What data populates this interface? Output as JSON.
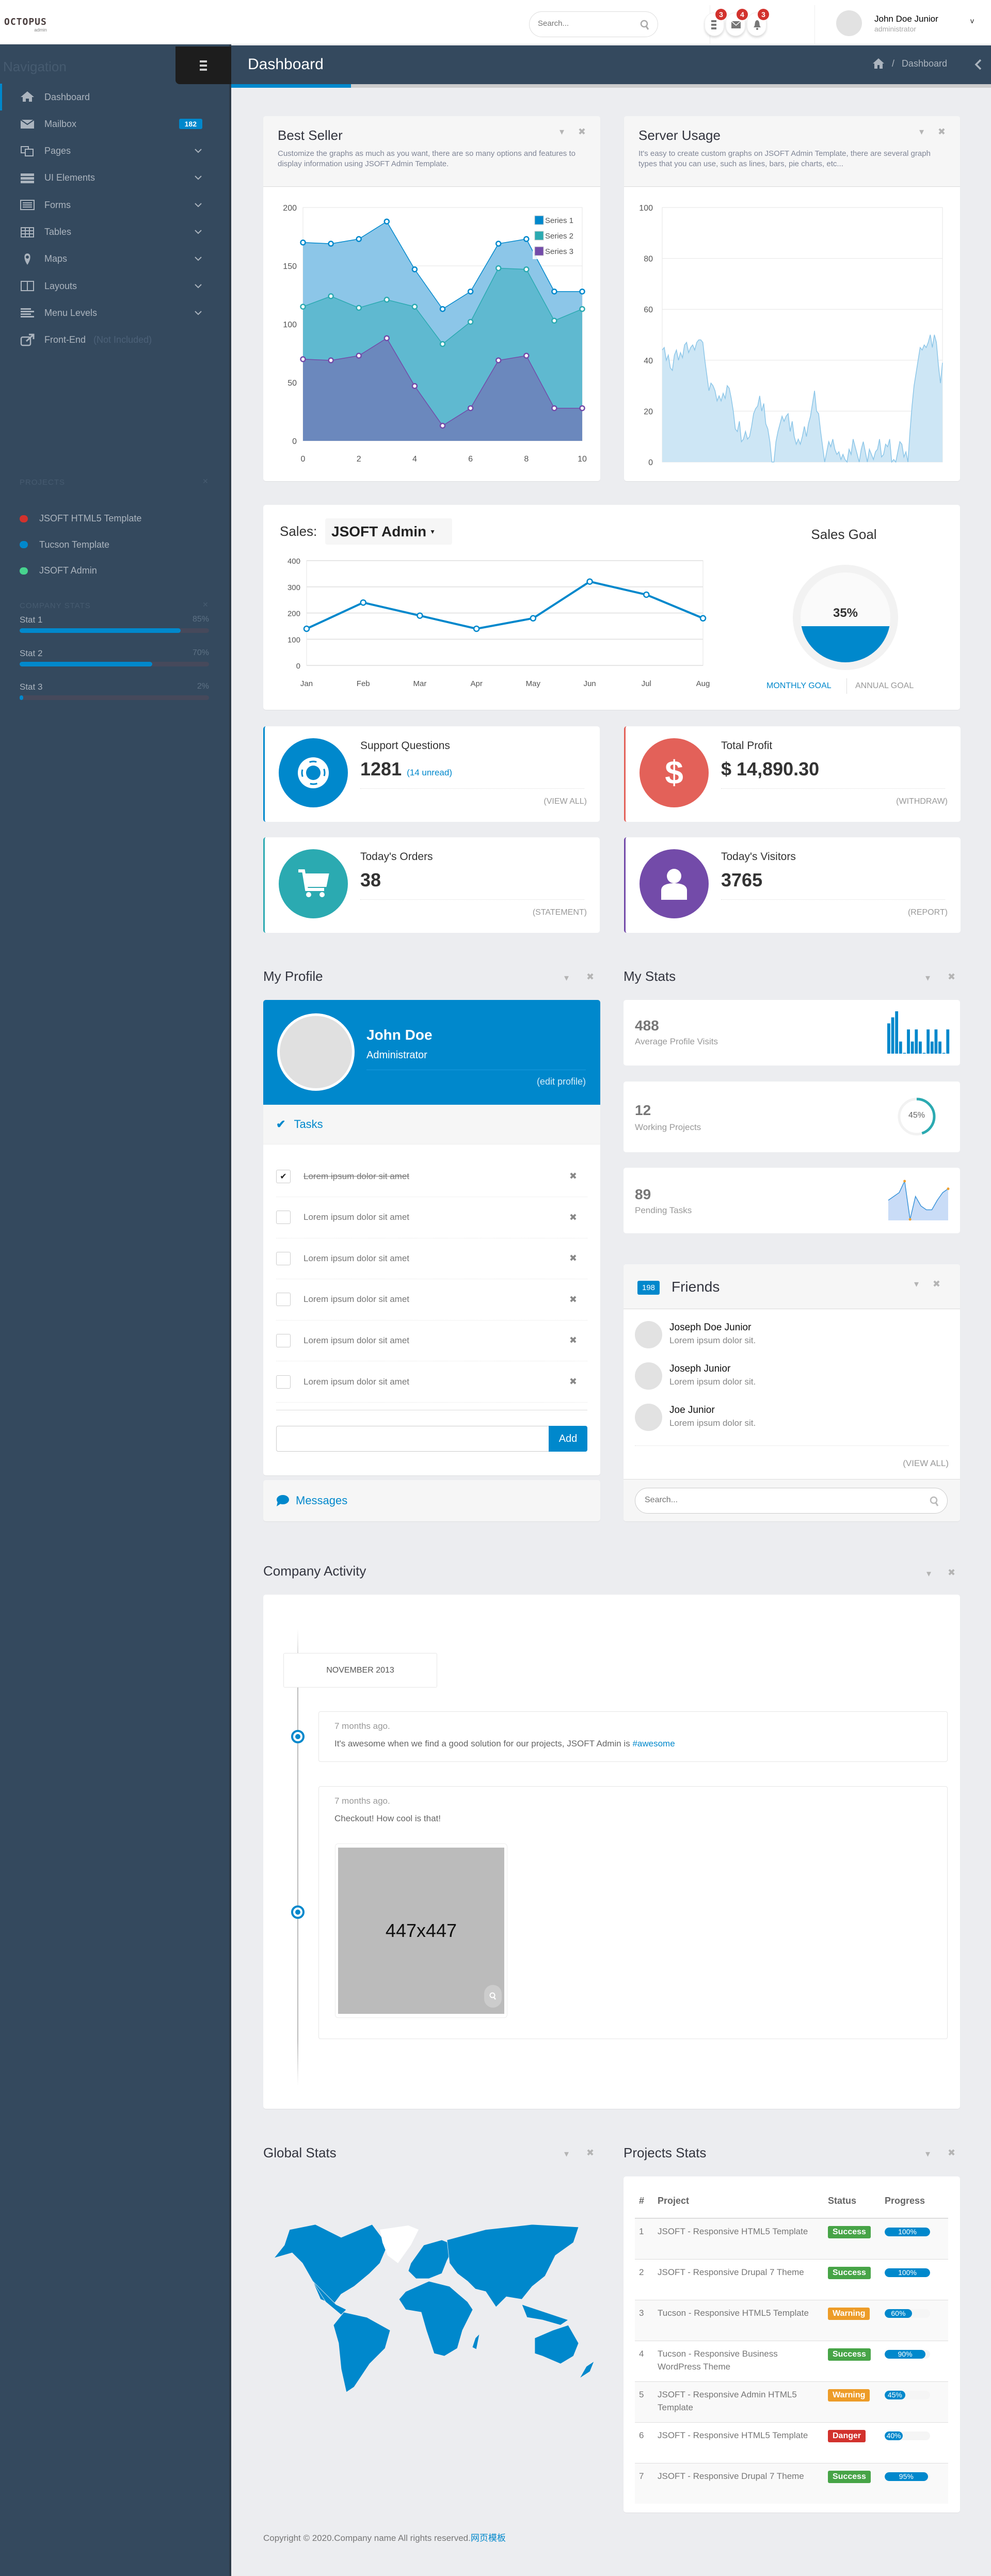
{
  "header": {
    "logo": "OCTOPUS",
    "logo_sub": "admin",
    "search_placeholder": "Search...",
    "notifications": [
      {
        "icon": "tasks-icon",
        "count": "3"
      },
      {
        "icon": "envelope-icon",
        "count": "4"
      },
      {
        "icon": "bell-icon",
        "count": "3"
      }
    ],
    "user_name": "John Doe Junior",
    "user_role": "administrator"
  },
  "page": {
    "title": "Dashboard",
    "breadcrumb": [
      "Dashboard"
    ]
  },
  "sidebar": {
    "nav_title": "Navigation",
    "items": [
      {
        "label": "Dashboard",
        "icon": "home-icon",
        "active": true
      },
      {
        "label": "Mailbox",
        "icon": "envelope-icon",
        "badge": "182"
      },
      {
        "label": "Pages",
        "icon": "copy-icon",
        "chevron": true
      },
      {
        "label": "UI Elements",
        "icon": "tasks-icon",
        "chevron": true
      },
      {
        "label": "Forms",
        "icon": "list-alt-icon",
        "chevron": true
      },
      {
        "label": "Tables",
        "icon": "table-icon",
        "chevron": true
      },
      {
        "label": "Maps",
        "icon": "map-marker-icon",
        "chevron": true
      },
      {
        "label": "Layouts",
        "icon": "columns-icon",
        "chevron": true
      },
      {
        "label": "Menu Levels",
        "icon": "align-left-icon",
        "chevron": true
      },
      {
        "label": "Front-End",
        "icon": "external-link-icon",
        "note": "(Not Included)"
      }
    ],
    "projects_title": "Projects",
    "projects": [
      {
        "label": "JSOFT HTML5 Template",
        "color": "#d2322d"
      },
      {
        "label": "Tucson Template",
        "color": "#0088cc"
      },
      {
        "label": "JSOFT Admin",
        "color": "#47d38e"
      }
    ],
    "stats_title": "Company Stats",
    "stats": [
      {
        "label": "Stat 1",
        "value": "85%",
        "pct": 85
      },
      {
        "label": "Stat 2",
        "value": "70%",
        "pct": 70
      },
      {
        "label": "Stat 3",
        "value": "2%",
        "pct": 2
      }
    ]
  },
  "best_seller": {
    "title": "Best Seller",
    "desc": "Customize the graphs as much as you want, there are so many options and features to display information using JSOFT Admin Template."
  },
  "server_usage": {
    "title": "Server Usage",
    "desc": "It's easy to create custom graphs on JSOFT Admin Template, there are several graph types that you can use, such as lines, bars, pie charts, etc..."
  },
  "sales": {
    "label": "Sales:",
    "selected": "JSOFT Admin",
    "goal_title": "Sales Goal",
    "goal_value": "35%",
    "goal_pct": 35,
    "tab_monthly": "MONTHLY GOAL",
    "tab_annual": "ANNUAL GOAL"
  },
  "widgets": [
    {
      "title": "Support Questions",
      "value": "1281",
      "extra": "(14 unread)",
      "link": "(view all)",
      "color": "#0088cc",
      "icon": "life-ring-icon"
    },
    {
      "title": "Total Profit",
      "value": "$ 14,890.30",
      "link": "(withdraw)",
      "color": "#e36159",
      "icon": "dollar-icon"
    },
    {
      "title": "Today's Orders",
      "value": "38",
      "link": "(statement)",
      "color": "#2baab1",
      "icon": "shopping-cart-icon"
    },
    {
      "title": "Today's Visitors",
      "value": "3765",
      "link": "(report)",
      "color": "#734ba9",
      "icon": "user-icon"
    }
  ],
  "profile": {
    "section_title": "My Profile",
    "name": "John Doe",
    "role": "Administrator",
    "edit": "(edit profile)",
    "tasks_title": "Tasks",
    "tasks": [
      {
        "text": "Lorem ipsum dolor sit amet",
        "done": true
      },
      {
        "text": "Lorem ipsum dolor sit amet",
        "done": false
      },
      {
        "text": "Lorem ipsum dolor sit amet",
        "done": false
      },
      {
        "text": "Lorem ipsum dolor sit amet",
        "done": false
      },
      {
        "text": "Lorem ipsum dolor sit amet",
        "done": false
      },
      {
        "text": "Lorem ipsum dolor sit amet",
        "done": false
      }
    ],
    "add_label": "Add",
    "messages": "Messages"
  },
  "my_stats": {
    "section_title": "My Stats",
    "cards": [
      {
        "value": "488",
        "label": "Average Profile Visits"
      },
      {
        "value": "12",
        "label": "Working Projects",
        "donut": "45%",
        "donut_pct": 45
      },
      {
        "value": "89",
        "label": "Pending Tasks"
      }
    ],
    "bars": [
      5,
      6,
      7,
      2,
      0.1,
      4,
      2,
      4,
      2,
      0.1,
      4,
      2,
      4,
      2,
      0.1,
      4
    ],
    "line": [
      5,
      6,
      7,
      10,
      0,
      6,
      3.5,
      2.5,
      2.5,
      5,
      7,
      8
    ]
  },
  "friends": {
    "count": "198",
    "title": "Friends",
    "list": [
      {
        "name": "Joseph Doe Junior",
        "desc": "Lorem ipsum dolor sit."
      },
      {
        "name": "Joseph Junior",
        "desc": "Lorem ipsum dolor sit."
      },
      {
        "name": "Joe Junior",
        "desc": "Lorem ipsum dolor sit."
      }
    ],
    "view_all": "(VIEW ALL)",
    "search_placeholder": "Search..."
  },
  "activity": {
    "section_title": "Company Activity",
    "month": "NOVEMBER 2013",
    "items": [
      {
        "time": "7 months ago.",
        "text": "It's awesome when we find a good solution for our projects, JSOFT Admin is ",
        "tag": "#awesome"
      },
      {
        "time": "7 months ago.",
        "text": "Checkout! How cool is that!",
        "image": "447x447"
      }
    ]
  },
  "global_stats": {
    "section_title": "Global Stats"
  },
  "projects_stats": {
    "section_title": "Projects Stats",
    "columns": [
      "#",
      "Project",
      "Status",
      "Progress"
    ],
    "rows": [
      {
        "n": "1",
        "project": "JSOFT - Responsive HTML5 Template",
        "status": "Success",
        "progress": "100%",
        "pct": 100
      },
      {
        "n": "2",
        "project": "JSOFT - Responsive Drupal 7 Theme",
        "status": "Success",
        "progress": "100%",
        "pct": 100
      },
      {
        "n": "3",
        "project": "Tucson - Responsive HTML5 Template",
        "status": "Warning",
        "progress": "60%",
        "pct": 60
      },
      {
        "n": "4",
        "project": "Tucson - Responsive Business WordPress Theme",
        "status": "Success",
        "progress": "90%",
        "pct": 90
      },
      {
        "n": "5",
        "project": "JSOFT - Responsive Admin HTML5 Template",
        "status": "Warning",
        "progress": "45%",
        "pct": 45
      },
      {
        "n": "6",
        "project": "JSOFT - Responsive HTML5 Template",
        "status": "Danger",
        "progress": "40%",
        "pct": 40
      },
      {
        "n": "7",
        "project": "JSOFT - Responsive Drupal 7 Theme",
        "status": "Success",
        "progress": "95%",
        "pct": 95
      }
    ],
    "status_colors": {
      "Success": "#47a447",
      "Warning": "#ed9c28",
      "Danger": "#d2322d"
    }
  },
  "footer": {
    "text": "Copyright © 2020.Company name All rights reserved.",
    "link": "网页模板"
  },
  "chart_data": [
    {
      "type": "area",
      "stacked": true,
      "x": [
        0,
        1,
        2,
        3,
        4,
        5,
        6,
        7,
        8,
        9,
        10
      ],
      "xticks": [
        0,
        2,
        4,
        6,
        8,
        10
      ],
      "yticks": [
        0,
        50,
        100,
        150,
        200
      ],
      "ylim": [
        0,
        200
      ],
      "legend": "top-right",
      "series": [
        {
          "name": "Series 1",
          "color": "#0088cc",
          "values": [
            55,
            45,
            59,
            67,
            32,
            30,
            26,
            21,
            26,
            25,
            15
          ]
        },
        {
          "name": "Series 2",
          "color": "#2baab1",
          "values": [
            45,
            55,
            41,
            33,
            68,
            70,
            74,
            79,
            74,
            75,
            85
          ]
        },
        {
          "name": "Series 3",
          "color": "#734ba9",
          "values": [
            70,
            69,
            73,
            88,
            47,
            13,
            28,
            69,
            73,
            28,
            28
          ]
        }
      ]
    },
    {
      "type": "area",
      "yticks": [
        0,
        20,
        40,
        60,
        80,
        100
      ],
      "ylim": [
        0,
        100
      ],
      "color": "#8cc6e8",
      "values": [
        44,
        45,
        40,
        42,
        37,
        36,
        42,
        44,
        40,
        43,
        41,
        46,
        47,
        43,
        45,
        46,
        44,
        47,
        48,
        48,
        47,
        40,
        34,
        28,
        31,
        30,
        28,
        24,
        26,
        24,
        27,
        25,
        30,
        29,
        25,
        20,
        13,
        12,
        16,
        8,
        9,
        12,
        9,
        10,
        14,
        19,
        21,
        22,
        26,
        20,
        23,
        15,
        13,
        8,
        0,
        0,
        8,
        12,
        15,
        18,
        16,
        18,
        19,
        12,
        16,
        10,
        7,
        9,
        7,
        10,
        14,
        10,
        15,
        18,
        23,
        28,
        20,
        19,
        12,
        6,
        0,
        4,
        8,
        6,
        9,
        5,
        3,
        4,
        1,
        3,
        1,
        0,
        5,
        3,
        9,
        6,
        3,
        0,
        5,
        8,
        4,
        0,
        5,
        3,
        1,
        4,
        5,
        9,
        2,
        3,
        7,
        6,
        9,
        0,
        1,
        0,
        4,
        8,
        7,
        2,
        4,
        0,
        12,
        22,
        30,
        35,
        40,
        45,
        44,
        46,
        45,
        47,
        50,
        45,
        50,
        47,
        38,
        31,
        39
      ]
    },
    {
      "type": "line",
      "categories": [
        "Jan",
        "Feb",
        "Mar",
        "Apr",
        "May",
        "Jun",
        "Jul",
        "Aug"
      ],
      "values": [
        140,
        240,
        190,
        140,
        180,
        320,
        270,
        180
      ],
      "yticks": [
        0,
        100,
        200,
        300,
        400
      ],
      "ylim": [
        0,
        400
      ],
      "color": "#0088cc"
    }
  ]
}
